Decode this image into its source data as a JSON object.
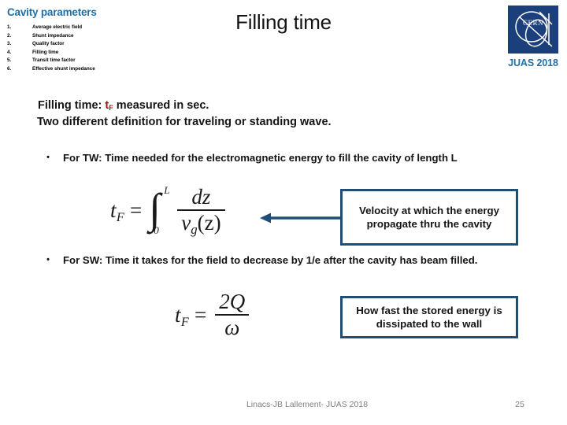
{
  "header": {
    "section_title": "Cavity parameters",
    "section_title_color": "#1F6FA8",
    "slide_title": "Filling time",
    "badge": "JUAS 2018",
    "badge_color": "#1F6FA8",
    "logo_name": "cern-logo",
    "logo_color": "#1A3F7A",
    "params": [
      {
        "num": "1.",
        "label": "Average electric field"
      },
      {
        "num": "2.",
        "label": "Shunt impedance"
      },
      {
        "num": "3.",
        "label": "Quality factor"
      },
      {
        "num": "4.",
        "label": "Filling time"
      },
      {
        "num": "5.",
        "label": "Transit time factor"
      },
      {
        "num": "6.",
        "label": "Effective shunt impedance"
      }
    ]
  },
  "body": {
    "intro_line_1_before": "Filling time: ",
    "intro_line_1_symbol": "t",
    "intro_line_1_symbol_sub": "F",
    "intro_line_1_symbol_color": "#9E1A1A",
    "intro_line_1_after": " measured in sec.",
    "intro_line_2": "Two different definition for traveling or standing wave.",
    "bullet_marker": "•",
    "bullet_tw": "For TW: Time needed for the electromagnetic energy to fill the cavity of length L",
    "bullet_sw": "For SW: Time it takes for the field to decrease by 1/e after the cavity has beam filled."
  },
  "equations": {
    "tw": {
      "lhs_var": "t",
      "lhs_sub": "F",
      "relation": "=",
      "integral": "∫",
      "upper_limit": "L",
      "lower_limit": "0",
      "numerator": "dz",
      "denominator_var": "v",
      "denominator_sub": "g",
      "denominator_arg": "(z)",
      "plain": "t_F = ∫_0^L dz / v_g(z)"
    },
    "sw": {
      "lhs_var": "t",
      "lhs_sub": "F",
      "relation": "=",
      "numerator": "2Q",
      "denominator": "ω",
      "plain": "t_F = 2Q / ω"
    }
  },
  "callouts": {
    "border_color": "#1F4E79",
    "velocity": "Velocity at which the energy propagate thru the cavity",
    "dissipated": "How fast the stored energy is dissipated to the wall",
    "arrow_name": "arrow-left",
    "arrow_color": "#1F4E79"
  },
  "footer": {
    "text": "Linacs-JB Lallement- JUAS 2018",
    "page_number": "25",
    "color": "#7F7F7F"
  }
}
